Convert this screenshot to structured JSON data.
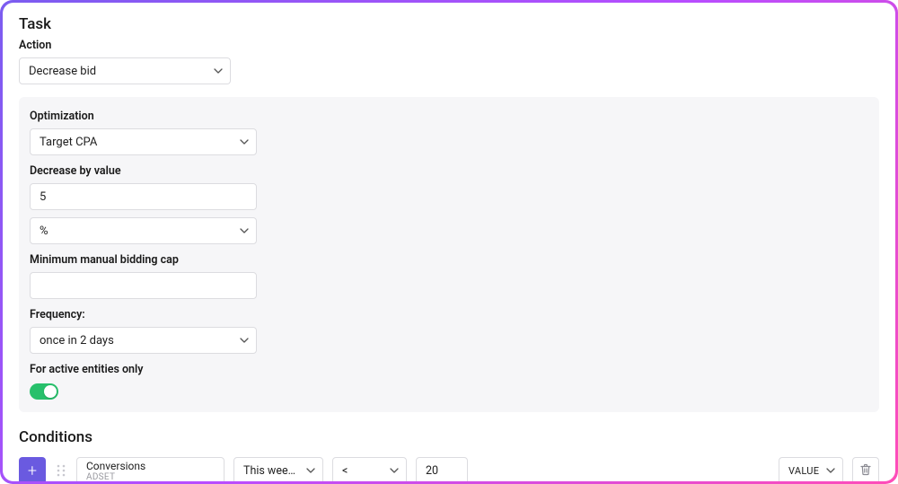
{
  "task": {
    "section_title": "Task",
    "action_label": "Action",
    "action_value": "Decrease bid",
    "opt": {
      "label": "Optimization",
      "value": "Target CPA",
      "decrease_label": "Decrease by value",
      "decrease_value": "5",
      "unit_value": "%",
      "min_cap_label": "Minimum manual bidding cap",
      "min_cap_value": "",
      "freq_label": "Frequency:",
      "freq_value": "once in 2 days",
      "active_label": "For active entities only",
      "active_on": true
    }
  },
  "conditions": {
    "title": "Conditions",
    "add_label": "+",
    "row": {
      "metric": "Conversions",
      "level": "ADSET",
      "timeframe": "This week (…",
      "operator": "<",
      "value": "20",
      "compare_type": "VALUE"
    }
  },
  "icons": {
    "chevron": "chevron-down-icon",
    "trash": "trash-icon",
    "drag": "drag-handle-icon"
  }
}
